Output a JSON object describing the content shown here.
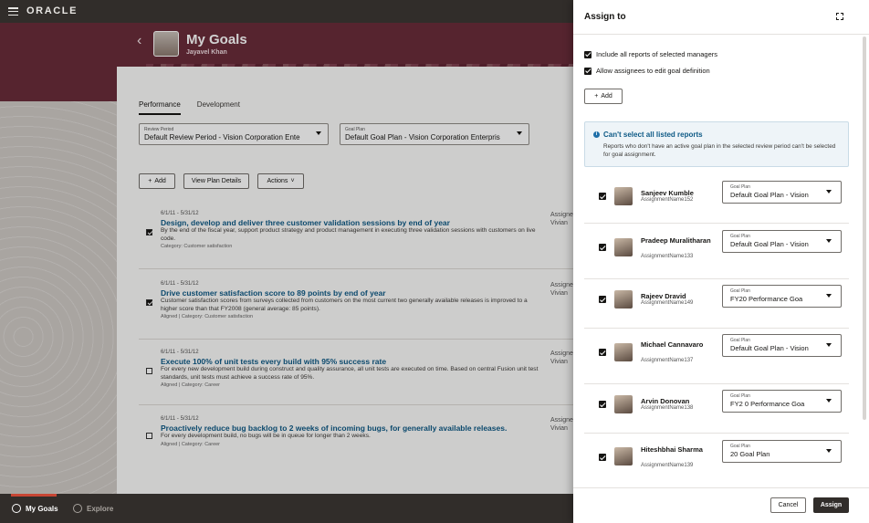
{
  "app": {
    "logo": "ORACLE"
  },
  "header": {
    "title": "My Goals",
    "subtitle": "Jayavel Khan"
  },
  "tabs": [
    {
      "label": "Performance"
    },
    {
      "label": "Development"
    }
  ],
  "filters": {
    "review_period": {
      "label": "Review Period",
      "value": "Default Review Period - Vision Corporation Ente"
    },
    "goal_plan": {
      "label": "Goal Plan",
      "value": "Default Goal Plan - Vision Corporation Enterpris"
    }
  },
  "toolbar": {
    "add": "Add",
    "view_plan": "View Plan Details",
    "actions": "Actions"
  },
  "goals": [
    {
      "checked": true,
      "date": "6/1/11 - 5/31/12",
      "title": "Design, develop and deliver three customer validation sessions by end of year",
      "desc": "By the end of the fiscal year, support product strategy and product management in executing three validation sessions with customers on live code.",
      "meta": "Category: Customer satisfaction",
      "assign_label": "Assigne",
      "assign_value": "Vivian"
    },
    {
      "checked": true,
      "date": "6/1/11 - 5/31/12",
      "title": "Drive customer satisfaction score to 89 points by end of year",
      "desc": "Customer satisfaction scores from surveys collected from customers on the most current two generally available releases is improved to a higher score than that FY2008 (general average: 85 points).",
      "meta": "Aligned | Category: Customer satisfaction",
      "assign_label": "Assigne",
      "assign_value": "Vivian"
    },
    {
      "checked": false,
      "date": "6/1/11 - 5/31/12",
      "title": "Execute 100% of unit tests every build with 95% success rate",
      "desc": "For every new development build during construct and quality assurance, all unit tests are executed on time. Based on central Fusion unit test standards, unit tests must achieve a success rate of 95%.",
      "meta": "Aligned | Category: Career",
      "assign_label": "Assigne",
      "assign_value": "Vivian"
    },
    {
      "checked": false,
      "date": "6/1/11 - 5/31/12",
      "title": "Proactively reduce bug backlog to 2 weeks of incoming bugs, for generally available releases.",
      "desc": "For every development build, no bugs will be in queue for longer than 2 weeks.",
      "meta": "Aligned | Category: Career",
      "assign_label": "Assigne",
      "assign_value": "Vivian"
    }
  ],
  "bottom_nav": {
    "my_goals": "My Goals",
    "explore": "Explore"
  },
  "drawer": {
    "title": "Assign to",
    "include_reports": "Include all reports of selected managers",
    "allow_edit": "Allow assignees to edit goal definition",
    "add": "Add",
    "info_title": "Can't select all listed reports",
    "info_text": "Reports who don't have an active goal plan in the selected review period can't be selected for goal assignment.",
    "goal_plan_label": "Goal Plan",
    "people": [
      {
        "name": "Sanjeev Kumble",
        "assignment": "AssignmentName152",
        "plan": "Default Goal Plan - Vision"
      },
      {
        "name": "Pradeep Muralitharan",
        "assignment": "AssignmentName133",
        "plan": "Default Goal Plan - Vision"
      },
      {
        "name": "Rajeev Dravid",
        "assignment": "AssignmentName149",
        "plan": "FY20   Performance Goa"
      },
      {
        "name": "Michael Cannavaro",
        "assignment": "AssignmentName137",
        "plan": "Default Goal Plan - Vision"
      },
      {
        "name": "Arvin Donovan",
        "assignment": "AssignmentName138",
        "plan": "FY2  0 Performance Goa"
      },
      {
        "name": "Hiteshbhai Sharma",
        "assignment": "AssignmentName139",
        "plan": "20    Goal Plan"
      }
    ],
    "cancel": "Cancel",
    "assign": "Assign"
  }
}
